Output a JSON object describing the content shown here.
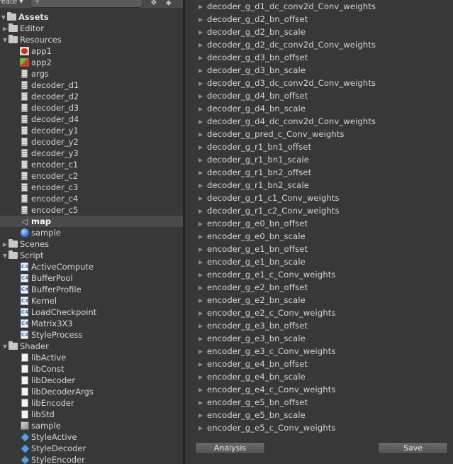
{
  "toolbar": {
    "create_label": "reate ▾",
    "search_icon": "search-icon"
  },
  "tree": {
    "root": "Assets",
    "items": [
      {
        "label": "Editor",
        "kind": "folder",
        "arrow": "▶"
      },
      {
        "label": "Resources",
        "kind": "folder",
        "arrow": "▼"
      },
      {
        "label": "app1",
        "kind": "image-red"
      },
      {
        "label": "app2",
        "kind": "image-green"
      },
      {
        "label": "args",
        "kind": "doc"
      },
      {
        "label": "decoder_d1",
        "kind": "doc"
      },
      {
        "label": "decoder_d2",
        "kind": "doc"
      },
      {
        "label": "decoder_d3",
        "kind": "doc"
      },
      {
        "label": "decoder_d4",
        "kind": "doc"
      },
      {
        "label": "decoder_y1",
        "kind": "doc"
      },
      {
        "label": "decoder_y2",
        "kind": "doc"
      },
      {
        "label": "decoder_y3",
        "kind": "doc"
      },
      {
        "label": "encoder_c1",
        "kind": "doc"
      },
      {
        "label": "encoder_c2",
        "kind": "doc"
      },
      {
        "label": "encoder_c3",
        "kind": "doc"
      },
      {
        "label": "encoder_c4",
        "kind": "doc"
      },
      {
        "label": "encoder_c5",
        "kind": "doc"
      },
      {
        "label": "map",
        "kind": "map",
        "selected": true
      },
      {
        "label": "sample",
        "kind": "sphere"
      },
      {
        "label": "Scenes",
        "kind": "folder",
        "arrow": "▶"
      },
      {
        "label": "Script",
        "kind": "folder",
        "arrow": "▼"
      },
      {
        "label": "ActiveCompute",
        "kind": "cs"
      },
      {
        "label": "BufferPool",
        "kind": "cs"
      },
      {
        "label": "BufferProfile",
        "kind": "cs"
      },
      {
        "label": "Kernel",
        "kind": "cs"
      },
      {
        "label": "LoadCheckpoint",
        "kind": "cs"
      },
      {
        "label": "Matrix3X3",
        "kind": "cs"
      },
      {
        "label": "StyleProcess",
        "kind": "cs"
      },
      {
        "label": "Shader",
        "kind": "folder",
        "arrow": "▼"
      },
      {
        "label": "libActive",
        "kind": "shader"
      },
      {
        "label": "libConst",
        "kind": "shader"
      },
      {
        "label": "libDecoder",
        "kind": "shader"
      },
      {
        "label": "libDecoderArgs",
        "kind": "shader"
      },
      {
        "label": "libEncoder",
        "kind": "shader"
      },
      {
        "label": "libStd",
        "kind": "shader"
      },
      {
        "label": "sample",
        "kind": "material"
      },
      {
        "label": "StyleActive",
        "kind": "compute"
      },
      {
        "label": "StyleDecoder",
        "kind": "compute"
      },
      {
        "label": "StyleEncoder",
        "kind": "compute"
      }
    ]
  },
  "weights": [
    "decoder_g_d1_dc_conv2d_Conv_weights",
    "decoder_g_d2_bn_offset",
    "decoder_g_d2_bn_scale",
    "decoder_g_d2_dc_conv2d_Conv_weights",
    "decoder_g_d3_bn_offset",
    "decoder_g_d3_bn_scale",
    "decoder_g_d3_dc_conv2d_Conv_weights",
    "decoder_g_d4_bn_offset",
    "decoder_g_d4_bn_scale",
    "decoder_g_d4_dc_conv2d_Conv_weights",
    "decoder_g_pred_c_Conv_weights",
    "decoder_g_r1_bn1_offset",
    "decoder_g_r1_bn1_scale",
    "decoder_g_r1_bn2_offset",
    "decoder_g_r1_bn2_scale",
    "decoder_g_r1_c1_Conv_weights",
    "decoder_g_r1_c2_Conv_weights",
    "encoder_g_e0_bn_offset",
    "encoder_g_e0_bn_scale",
    "encoder_g_e1_bn_offset",
    "encoder_g_e1_bn_scale",
    "encoder_g_e1_c_Conv_weights",
    "encoder_g_e2_bn_offset",
    "encoder_g_e2_bn_scale",
    "encoder_g_e2_c_Conv_weights",
    "encoder_g_e3_bn_offset",
    "encoder_g_e3_bn_scale",
    "encoder_g_e3_c_Conv_weights",
    "encoder_g_e4_bn_offset",
    "encoder_g_e4_bn_scale",
    "encoder_g_e4_c_Conv_weights",
    "encoder_g_e5_bn_offset",
    "encoder_g_e5_bn_scale",
    "encoder_g_e5_c_Conv_weights"
  ],
  "buttons": {
    "analysis": "Analysis",
    "save": "Save"
  },
  "colors": {
    "panel_bg": "#383838",
    "selected_bg": "#4a4a4a",
    "text": "#d6d6d6"
  }
}
